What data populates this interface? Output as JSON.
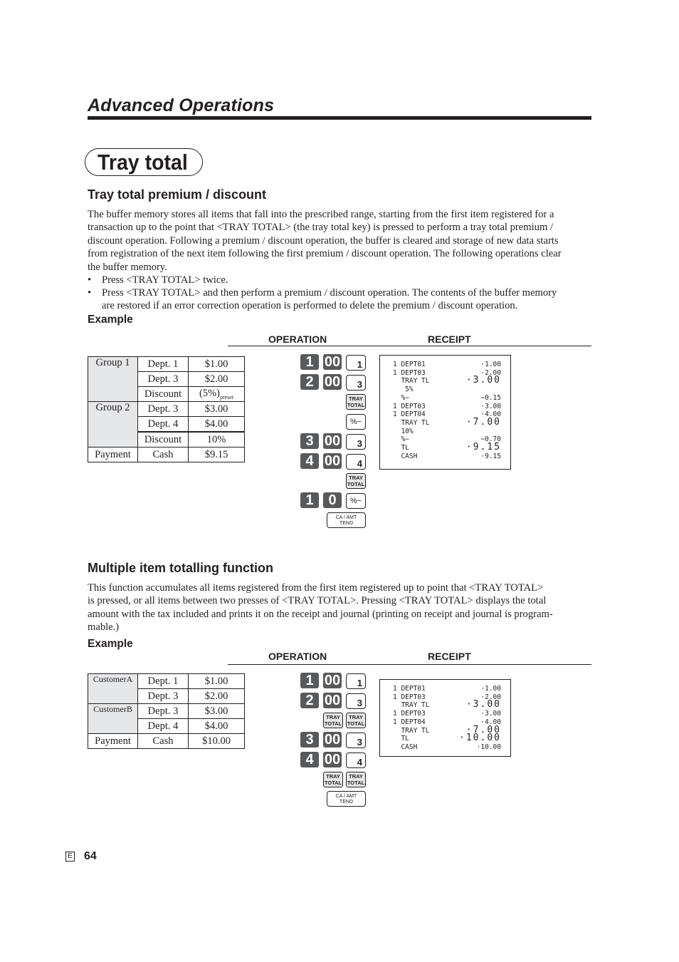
{
  "chapter_title": "Advanced Operations",
  "page_title": "Tray total",
  "section1": {
    "heading": "Tray total premium / discount",
    "paragraph_lines": [
      "The buffer memory stores all items that fall into the prescribed range, starting from the first item registered for a",
      "transaction up to the point that <TRAY TOTAL> (the tray total key) is pressed to perform a tray total premium /",
      "discount operation. Following a premium / discount operation, the buffer is cleared and storage of new data starts",
      "from registration of the next item following the first premium / discount operation. The following operations clear",
      "the buffer memory."
    ],
    "bullets": [
      {
        "lines": [
          "Press <TRAY TOTAL> twice."
        ]
      },
      {
        "lines": [
          "Press <TRAY TOTAL> and then perform a premium / discount operation. The contents of the buffer memory",
          "are restored if an error correction operation is performed to delete the premium / discount operation."
        ]
      }
    ],
    "bullet_char": "•",
    "example_label": "Example",
    "operation_label": "OPERATION",
    "receipt_label": "RECEIPT",
    "table": {
      "groups": [
        {
          "name": "Group 1",
          "rows": [
            [
              "Dept. 1",
              "$1.00"
            ],
            [
              "Dept. 3",
              "$2.00"
            ],
            [
              "Discount",
              "(5%)",
              "preset"
            ]
          ]
        },
        {
          "name": "Group 2",
          "rows": [
            [
              "Dept. 3",
              "$3.00"
            ],
            [
              "Dept. 4",
              "$4.00"
            ],
            [
              "Discount",
              "10%"
            ]
          ]
        }
      ],
      "payment": [
        "Payment",
        "Cash",
        "$9.15"
      ]
    },
    "keys": {
      "k1": "1",
      "k00": "00",
      "k2": "2",
      "k3": "3",
      "k4": "4",
      "k0": "0",
      "dept1": "1",
      "dept3": "3",
      "dept4": "4",
      "tray_top": "TRAY",
      "tray_bottom": "TOTAL",
      "pct": "%−",
      "ca_top": "CA / AMT",
      "ca_bottom": "TEND"
    },
    "receipt_lines": [
      {
        "left": "1 DEPT01",
        "right": "·1.00",
        "big": false
      },
      {
        "left": "1 DEPT03",
        "right": "·2.00",
        "big": false
      },
      {
        "left": "  TRAY TL",
        "right": "·3.00",
        "big": true
      },
      {
        "left": "   5%",
        "right": "",
        "big": false
      },
      {
        "left": "  %−",
        "right": "−0.15",
        "big": false
      },
      {
        "left": "1 DEPT03",
        "right": "·3.00",
        "big": false
      },
      {
        "left": "1 DEPT04",
        "right": "·4.00",
        "big": false
      },
      {
        "left": "  TRAY TL",
        "right": "·7.00",
        "big": true
      },
      {
        "left": "  10%",
        "right": "",
        "big": false
      },
      {
        "left": "  %−",
        "right": "−0.70",
        "big": false
      },
      {
        "left": "  TL",
        "right": "·9.15",
        "big": true
      },
      {
        "left": "  CASH",
        "right": "·9.15",
        "big": false
      }
    ]
  },
  "section2": {
    "heading": "Multiple item totalling function",
    "paragraph_lines": [
      "This function accumulates all items registered from the first item registered up to point that <TRAY TOTAL>",
      "is pressed, or all items between two presses of <TRAY TOTAL>. Pressing <TRAY TOTAL> displays the total",
      "amount with the tax included and prints it on the receipt and journal (printing on receipt and journal is program-",
      "mable.)"
    ],
    "example_label": "Example",
    "operation_label": "OPERATION",
    "receipt_label": "RECEIPT",
    "table": {
      "groups": [
        {
          "name": "CustomerA",
          "rows": [
            [
              "Dept. 1",
              "$1.00"
            ],
            [
              "Dept. 3",
              "$2.00"
            ]
          ]
        },
        {
          "name": "CustomerB",
          "rows": [
            [
              "Dept. 3",
              "$3.00"
            ],
            [
              "Dept. 4",
              "$4.00"
            ]
          ]
        }
      ],
      "payment": [
        "Payment",
        "Cash",
        "$10.00"
      ]
    },
    "receipt_lines": [
      {
        "left": "1 DEPT01",
        "right": "·1.00",
        "big": false
      },
      {
        "left": "1 DEPT03",
        "right": "·2.00",
        "big": false
      },
      {
        "left": "  TRAY TL",
        "right": "·3.00",
        "big": true
      },
      {
        "left": "1 DEPT03",
        "right": "·3.00",
        "big": false
      },
      {
        "left": "1 DEPT04",
        "right": "·4.00",
        "big": false
      },
      {
        "left": "  TRAY TL",
        "right": "·7.00",
        "big": true
      },
      {
        "left": "  TL",
        "right": "·10.00",
        "big": true
      },
      {
        "left": "  CASH",
        "right": "·10.00",
        "big": false
      }
    ]
  },
  "footer": {
    "language_mark": "E",
    "page_number": "64"
  }
}
